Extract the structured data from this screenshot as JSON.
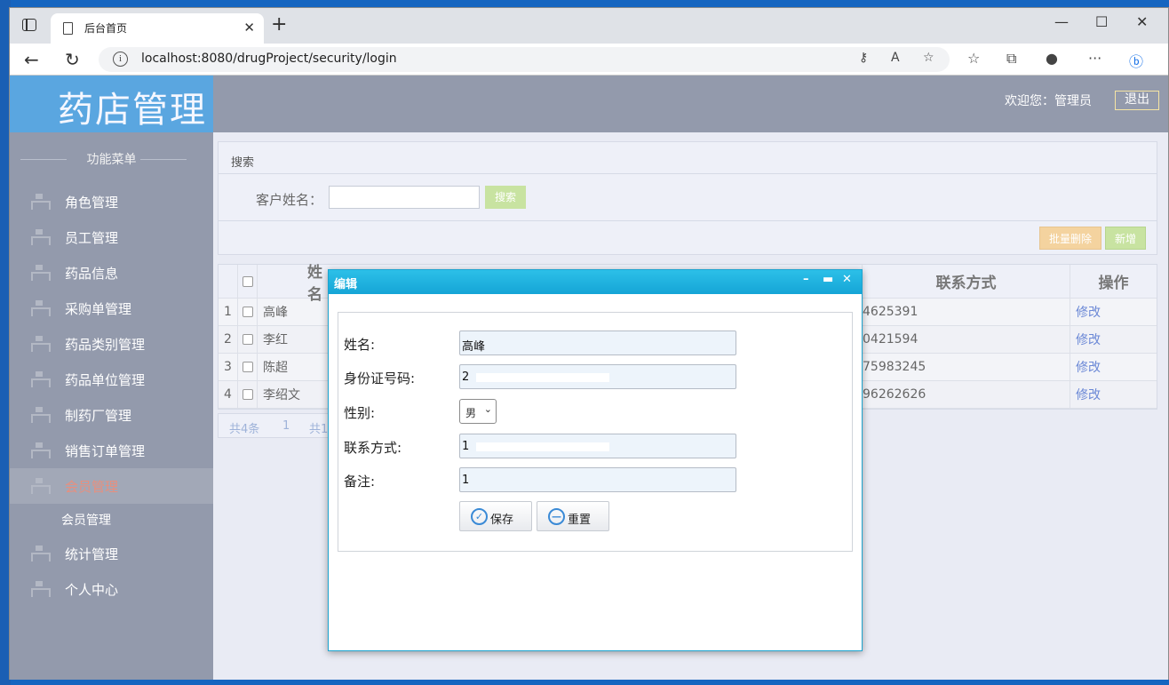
{
  "browser": {
    "tab_title": "后台首页",
    "url": "localhost:8080/drugProject/security/login"
  },
  "app": {
    "logo": "药店管理",
    "welcome": "欢迎您：管理员",
    "logout": "退出",
    "menu_title": "功能菜单",
    "menu": [
      "角色管理",
      "员工管理",
      "药品信息",
      "采购单管理",
      "药品类别管理",
      "药品单位管理",
      "制药厂管理",
      "销售订单管理",
      "会员管理",
      "会员管理",
      "统计管理",
      "个人中心"
    ]
  },
  "search": {
    "header": "搜索",
    "label": "客户姓名：",
    "button": "搜索"
  },
  "toolbar": {
    "batch_delete": "批量删除",
    "add": "新增"
  },
  "table": {
    "headers": {
      "name": "姓名",
      "contact": "联系方式",
      "op": "操作"
    },
    "rows": [
      {
        "idx": "1",
        "name": "高峰",
        "contact": "4625391",
        "op": "修改"
      },
      {
        "idx": "2",
        "name": "李红",
        "contact": "0421594",
        "op": "修改"
      },
      {
        "idx": "3",
        "name": "陈超",
        "contact": "75983245",
        "op": "修改"
      },
      {
        "idx": "4",
        "name": "李绍文",
        "contact": "96262626",
        "op": "修改"
      }
    ]
  },
  "pager": {
    "total": "共4条",
    "page": "1",
    "pages": "共1"
  },
  "dialog": {
    "title": "编辑",
    "fields": {
      "name_label": "姓名:",
      "name_value": "高峰",
      "id_label": "身份证号码:",
      "id_value": "2",
      "gender_label": "性别:",
      "gender_value": "男",
      "contact_label": "联系方式:",
      "contact_value": "1",
      "note_label": "备注:",
      "note_value": "1"
    },
    "save": "保存",
    "reset": "重置"
  }
}
